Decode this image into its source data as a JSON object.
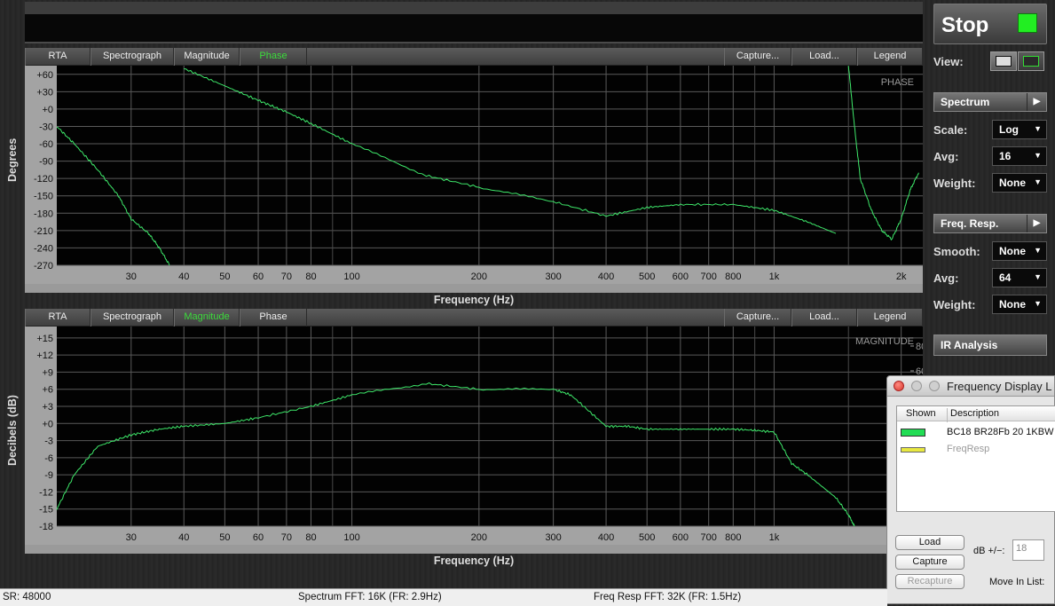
{
  "tabs": {
    "rta": "RTA",
    "spectrograph": "Spectrograph",
    "magnitude": "Magnitude",
    "phase": "Phase",
    "capture": "Capture...",
    "load": "Load...",
    "legend": "Legend"
  },
  "phase_plot": {
    "active_tab": "phase",
    "corner_label": "PHASE",
    "y_axis_label": "Degrees",
    "x_axis_label": "Frequency (Hz)",
    "y_ticks": [
      "+60",
      "+30",
      "+0",
      "-30",
      "-60",
      "-90",
      "-120",
      "-150",
      "-180",
      "-210",
      "-240",
      "-270"
    ]
  },
  "magnitude_plot": {
    "active_tab": "magnitude",
    "corner_label": "MAGNITUDE",
    "y_axis_label": "Decibels (dB)",
    "x_axis_label": "Frequency (Hz)",
    "y_ticks": [
      "+15",
      "+12",
      "+9",
      "+6",
      "+3",
      "+0",
      "-3",
      "-6",
      "-9",
      "-12",
      "-15",
      "-18"
    ],
    "right_ticks": [
      "80",
      "60"
    ]
  },
  "x_ticks": [
    "30",
    "40",
    "50",
    "60",
    "70",
    "80",
    "100",
    "200",
    "300",
    "400",
    "500",
    "600",
    "700",
    "800",
    "1k",
    "2k"
  ],
  "right_panel": {
    "stop_label": "Stop",
    "view_label": "View:",
    "spectrum_section": "Spectrum",
    "scale_label": "Scale:",
    "scale_value": "Log",
    "avg_label": "Avg:",
    "spectrum_avg_value": "16",
    "weight_label": "Weight:",
    "spectrum_weight_value": "None",
    "freq_resp_section": "Freq. Resp.",
    "smooth_label": "Smooth:",
    "smooth_value": "None",
    "fr_avg_value": "64",
    "fr_weight_value": "None",
    "ir_analysis": "IR Analysis",
    "colors": {
      "stop_indicator": "#22ee22",
      "trace": "#3ee86a"
    }
  },
  "freq_display": {
    "title": "Frequency Display L",
    "col_shown": "Shown",
    "col_description": "Description",
    "rows": [
      {
        "description": "BC18 BR28Fb 20 1KBW",
        "swatch": "#22dd55"
      },
      {
        "description": "FreqResp",
        "swatch": "#e8e840"
      }
    ],
    "load_button": "Load",
    "capture_button": "Capture",
    "recapture_button": "Recapture",
    "db_label": "dB +/−:",
    "db_value": "18",
    "move_label": "Move In List:"
  },
  "status": {
    "sr": "SR: 48000",
    "spectrum_fft": "Spectrum FFT: 16K (FR: 2.9Hz)",
    "freq_resp_fft": "Freq Resp FFT: 32K (FR: 1.5Hz)"
  },
  "chart_data": [
    {
      "type": "line",
      "title": "PHASE",
      "xlabel": "Frequency (Hz)",
      "ylabel": "Degrees",
      "x_scale": "log",
      "ylim": [
        -270,
        75
      ],
      "series": [
        {
          "x": [
            20,
            22,
            25,
            28,
            30,
            33,
            35,
            37
          ],
          "y": [
            -30,
            -60,
            -105,
            -150,
            -190,
            -215,
            -240,
            -270
          ]
        },
        {
          "x": [
            40,
            50,
            60,
            70,
            80,
            100,
            150,
            200,
            300,
            400,
            500,
            600,
            800,
            1000,
            1200,
            1400
          ],
          "y": [
            70,
            40,
            15,
            -5,
            -25,
            -60,
            -115,
            -135,
            -160,
            -185,
            -170,
            -165,
            -165,
            -175,
            -195,
            -215
          ]
        },
        {
          "x": [
            1500,
            1550,
            1600,
            1700,
            1800,
            1900,
            2000,
            2100,
            2200
          ],
          "y": [
            75,
            -30,
            -120,
            -175,
            -210,
            -225,
            -190,
            -140,
            -110
          ]
        }
      ]
    },
    {
      "type": "line",
      "title": "MAGNITUDE",
      "xlabel": "Frequency (Hz)",
      "ylabel": "Decibels (dB)",
      "x_scale": "log",
      "ylim": [
        -18,
        17
      ],
      "series": [
        {
          "x": [
            20,
            22,
            25,
            30,
            35,
            40,
            50,
            60,
            80,
            100,
            150,
            200,
            300,
            330,
            400,
            450,
            500,
            600,
            700,
            800,
            900,
            1000,
            1100,
            1200,
            1400,
            1500,
            1550
          ],
          "y": [
            -15,
            -9,
            -4,
            -2,
            -1,
            -0.5,
            0,
            1,
            3,
            5,
            7,
            6,
            6,
            5,
            -0.5,
            -0.5,
            -1,
            -1,
            -1,
            -1,
            -1.2,
            -1.5,
            -7,
            -9,
            -13,
            -16,
            -18
          ]
        }
      ]
    }
  ]
}
